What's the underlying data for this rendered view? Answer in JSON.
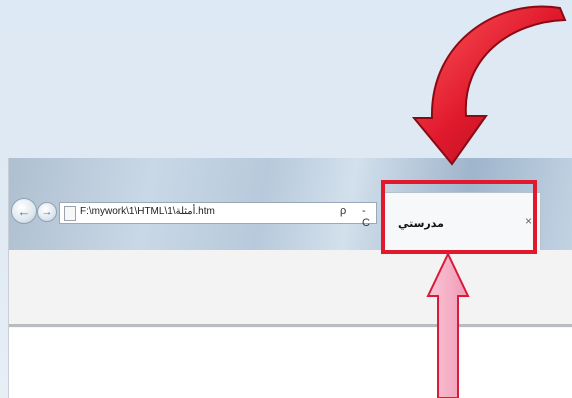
{
  "browser": {
    "address_bar": {
      "url": "F:\\mywork\\1\\HTML\\1\\أمثلة.htm"
    },
    "tab": {
      "title": "مدرستي",
      "close_label": "×"
    },
    "nav": {
      "back_label": "←",
      "forward_label": "→"
    },
    "search_glyph": "ρ",
    "refresh_glyph": "- C"
  },
  "annotations": {
    "curved_arrow_color": "#e0192d",
    "up_arrow_color": "#f4b6c9",
    "highlight_color": "#e0192d"
  }
}
